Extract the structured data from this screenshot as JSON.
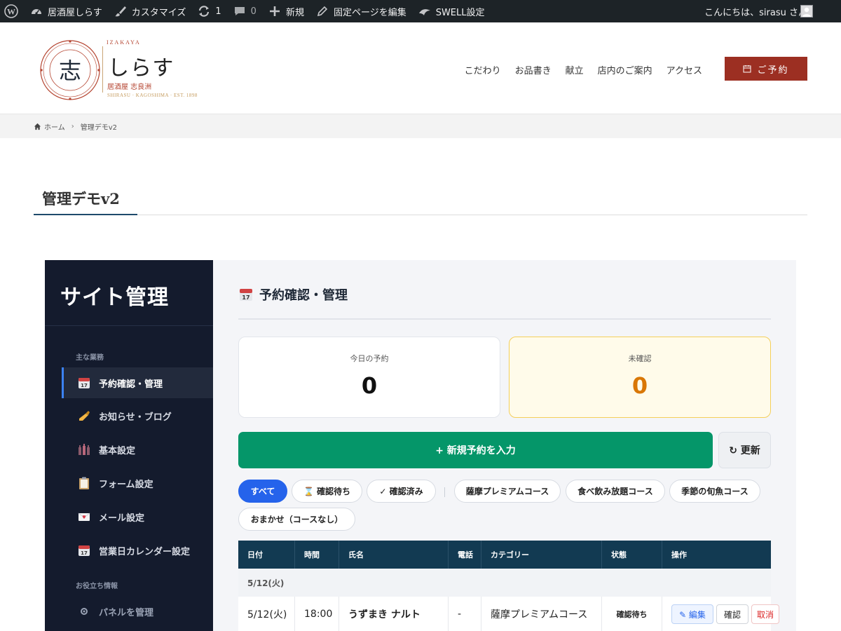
{
  "admin_bar": {
    "site_name": "居酒屋しらす",
    "customize": "カスタマイズ",
    "updates_count": "1",
    "comments_count": "0",
    "new_label": "新規",
    "edit_page": "固定ページを編集",
    "swell_settings": "SWELL設定",
    "greeting": "こんにちは、sirasu さん"
  },
  "logo": {
    "kanji": "志",
    "sub_top": "IZAKAYA",
    "name": "しらす",
    "jp_sub": "居酒屋 志良洲",
    "en_sub": "SHIRASU · KAGOSHIMA · EST. 1898"
  },
  "nav": {
    "items": [
      "こだわり",
      "お品書き",
      "献立",
      "店内のご案内",
      "アクセス"
    ],
    "reserve_label": "ご予約"
  },
  "breadcrumb": {
    "home": "ホーム",
    "current": "管理デモv2"
  },
  "page": {
    "title": "管理デモv2"
  },
  "sidebar": {
    "title": "サイト管理",
    "section_main": "主な業務",
    "section_tools": "お役立ち情報",
    "items": [
      {
        "label": "予約確認・管理",
        "icon": "calendar-icon"
      },
      {
        "label": "お知らせ・ブログ",
        "icon": "writing-hand-icon"
      },
      {
        "label": "基本設定",
        "icon": "bottles-icon"
      },
      {
        "label": "フォーム設定",
        "icon": "clipboard-icon"
      },
      {
        "label": "メール設定",
        "icon": "love-letter-icon"
      },
      {
        "label": "営業日カレンダー設定",
        "icon": "calendar-icon"
      }
    ],
    "tool_items": [
      {
        "label": "パネルを管理",
        "icon": "gear-icon"
      }
    ]
  },
  "main": {
    "heading": "予約確認・管理",
    "stats": {
      "today_label": "今日の予約",
      "today_value": "0",
      "unconfirmed_label": "未確認",
      "unconfirmed_value": "0"
    },
    "new_button": "+ 新規予約を入力",
    "refresh_button": "↻ 更新",
    "filters": [
      "すべて",
      "⌛ 確認待ち",
      "✓ 確認済み",
      "薩摩プレミアムコース",
      "食べ飲み放題コース",
      "季節の旬魚コース",
      "おまかせ（コースなし）"
    ],
    "table": {
      "headers": [
        "日付",
        "時間",
        "氏名",
        "電話",
        "カテゴリー",
        "状態",
        "操作"
      ],
      "group_label": "5/12(火)",
      "rows": [
        {
          "date": "5/12(火)",
          "time": "18:00",
          "name": "うずまき ナルト",
          "phone": "-",
          "category": "薩摩プレミアムコース",
          "status": "確認待ち",
          "actions": {
            "edit": "✎ 編集",
            "confirm": "確認",
            "cancel": "取消"
          }
        }
      ]
    }
  }
}
